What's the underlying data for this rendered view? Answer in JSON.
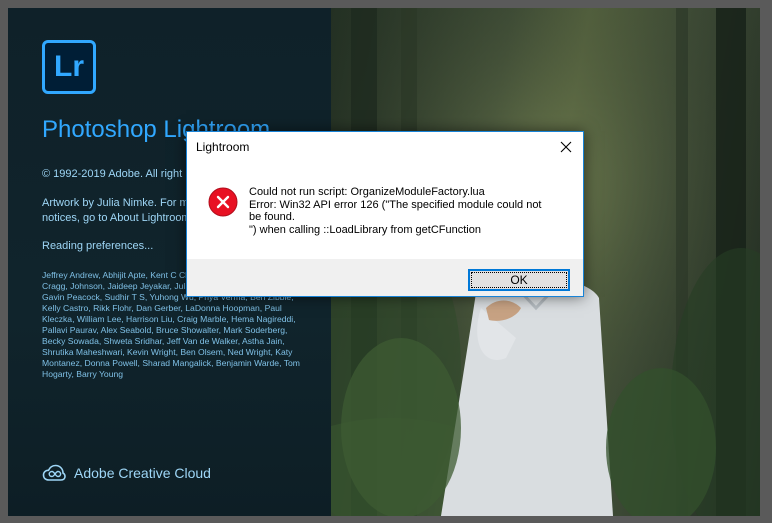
{
  "splash": {
    "logo_text": "Lr",
    "product_name": "Photoshop Lightroom",
    "copyright": "© 1992-2019 Adobe. All right",
    "artwork_lines": [
      "Artwork by Julia Nimke. For m",
      "notices, go to About Lightroom"
    ],
    "reading_status": "Reading preferences...",
    "credits": "Jeffrey Andrew, Abhijit Apte, Kent C Clarke, Jon Clauson, Michael Cragg, Johnson, Jaideep Jeyakar, Julie Kmo Murarka, Hari Panicker, Gavin Peacock, Sudhir T S, Yuhong Wu, Priya Verma, Ben Zibble, Kelly Castro, Rikk Flohr, Dan Gerber, LaDonna Hoopman, Paul Kleczka, William Lee, Harrison Liu, Craig Marble, Hema Nagireddi, Pallavi Paurav, Alex Seabold, Bruce Showalter, Mark Soderberg, Becky Sowada, Shweta Sridhar, Jeff Van de Walker, Astha Jain, Shrutika Maheshwari, Kevin Wright, Ben Olsem, Ned Wright, Katy Montanez, Donna Powell, Sharad Mangalick, Benjamin Warde, Tom Hogarty, Barry Young",
    "brand_label": "Adobe Creative Cloud"
  },
  "dialog": {
    "title": "Lightroom",
    "message_lines": [
      "Could not run script: OrganizeModuleFactory.lua",
      "Error: Win32 API error 126 (\"The specified module could not",
      "be found.",
      "\") when calling ::LoadLibrary from getCFunction"
    ],
    "ok_label": "OK",
    "icons": {
      "error": "error-x-icon",
      "close": "close-icon"
    }
  },
  "colors": {
    "lightroom_blue": "#31a8ff",
    "splash_panel": "#10242c",
    "dialog_accent": "#0078d7",
    "error_red": "#e81123"
  }
}
